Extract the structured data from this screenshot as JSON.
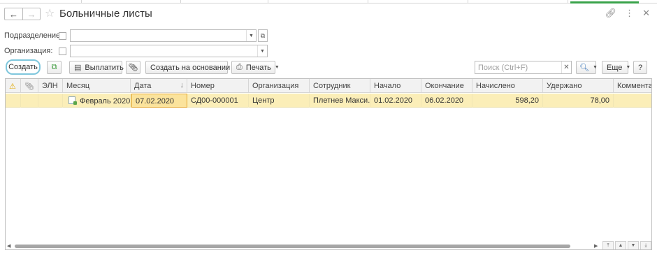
{
  "window": {
    "title": "Больничные листы",
    "back_icon": "arrow-left-icon",
    "forward_icon": "arrow-right-icon",
    "favorite_icon": "star-icon",
    "link_icon": "link-icon",
    "more_icon": "kebab-icon",
    "close_icon": "close-icon",
    "accent_color": "#3aa34b"
  },
  "filters": {
    "department_label": "Подразделение:",
    "department_value": "",
    "organization_label": "Организация:",
    "organization_value": ""
  },
  "toolbar": {
    "create_label": "Создать",
    "pay_label": "Выплатить",
    "create_based_on_label": "Создать на основании",
    "print_label": "Печать",
    "search_placeholder": "Поиск (Ctrl+F)",
    "more_label": "Еще",
    "help_label": "?"
  },
  "table": {
    "columns": [
      "ЭЛН",
      "Месяц",
      "Дата",
      "Номер",
      "Организация",
      "Сотрудник",
      "Начало",
      "Окончание",
      "Начислено",
      "Удержано",
      "Коммента"
    ],
    "sort_indicator": "↓",
    "rows": [
      {
        "month": "Февраль 2020",
        "date": "07.02.2020",
        "number": "СД00-000001",
        "organization": "Центр",
        "employee": "Плетнев Макси...",
        "start": "01.02.2020",
        "end": "06.02.2020",
        "accrued": "598,20",
        "withheld": "78,00",
        "comment": ""
      }
    ]
  },
  "colors": {
    "selected_row": "#fbeeb8",
    "active_cell_border": "#e4a630",
    "create_highlight": "#7fc7dd"
  }
}
